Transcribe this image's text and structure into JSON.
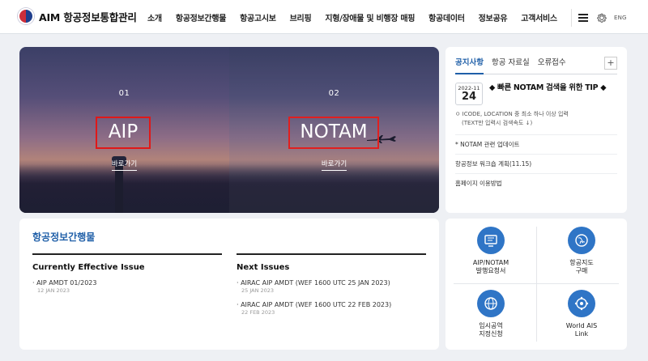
{
  "header": {
    "logo_text": "AIM 항공정보통합관리",
    "nav": [
      "소개",
      "항공정보간행물",
      "항공고시보",
      "브리핑",
      "지형/장애물 및 비행장 매핑",
      "항공데이터",
      "정보공유",
      "고객서비스"
    ],
    "lang_label": "ENG"
  },
  "banner": {
    "panels": [
      {
        "number": "01",
        "title": "AIP",
        "link": "바로가기"
      },
      {
        "number": "02",
        "title": "NOTAM",
        "link": "바로가기"
      }
    ],
    "highlight_color": "#e01818"
  },
  "notice": {
    "tabs": [
      "공지사항",
      "항공 자료실",
      "오류접수"
    ],
    "plus": "+",
    "feature": {
      "year_month": "2022-11",
      "day": "24",
      "title": "◆ 빠른 NOTAM 검색을 위한 TIP ◆",
      "desc_line1": "ㅇ ICODE, LOCATION 중 최소 하나 이상 입력",
      "desc_line2": "(TEXT만 입력시 검색속도 ↓)"
    },
    "items": [
      "* NOTAM 관련 업데이트",
      "항공정보 워크숍 계획(11.15)",
      "홈페이지 이용방법"
    ]
  },
  "pubs": {
    "title": "항공정보간행물",
    "current": {
      "heading": "Currently Effective Issue",
      "items": [
        {
          "title": "· AIP AMDT 01/2023",
          "date": "12 JAN 2023"
        }
      ]
    },
    "next": {
      "heading": "Next Issues",
      "items": [
        {
          "title": "· AIRAC AIP AMDT (WEF 1600 UTC 25 JAN 2023)",
          "date": "25 JAN 2023"
        },
        {
          "title": "· AIRAC AIP AMDT (WEF 1600 UTC 22 FEB 2023)",
          "date": "22 FEB 2023"
        }
      ]
    }
  },
  "quick": {
    "items": [
      {
        "line1": "AIP/NOTAM",
        "line2": "발행요청서",
        "icon": "document-monitor-icon"
      },
      {
        "line1": "항공지도",
        "line2": "구매",
        "icon": "globe-map-icon"
      },
      {
        "line1": "임시공역",
        "line2": "지정신청",
        "icon": "globe-icon"
      },
      {
        "line1": "World AIS",
        "line2": "Link",
        "icon": "world-network-icon"
      }
    ],
    "accent": "#2f75c6"
  }
}
